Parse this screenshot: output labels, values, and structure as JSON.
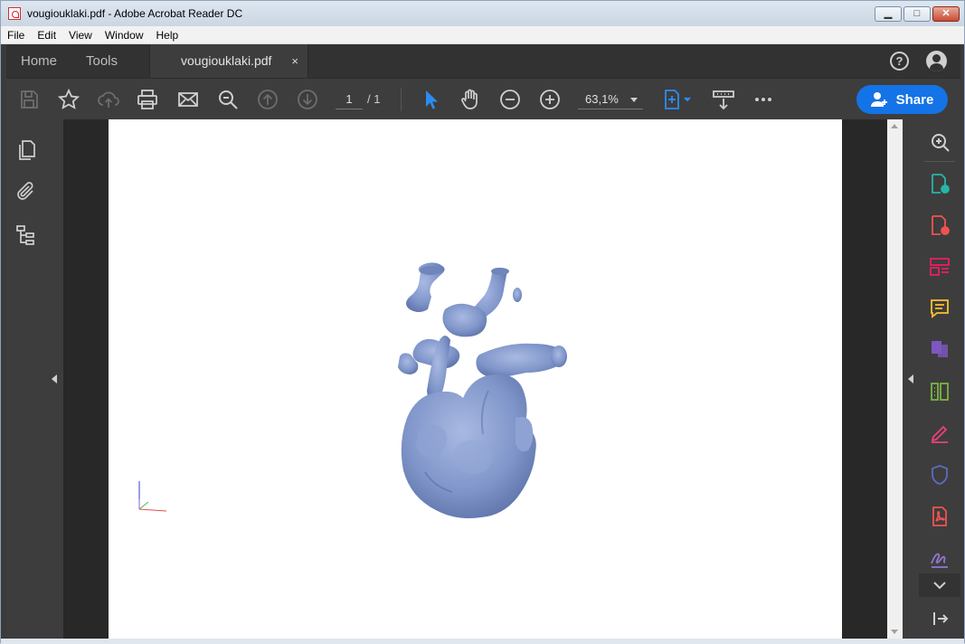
{
  "window": {
    "title": "vougiouklaki.pdf - Adobe Acrobat Reader DC",
    "buttons": {
      "minimize": "▁",
      "maximize": "□",
      "close": "✕"
    }
  },
  "menu": [
    "File",
    "Edit",
    "View",
    "Window",
    "Help"
  ],
  "tabs": {
    "home": "Home",
    "tools": "Tools",
    "document": "vougiouklaki.pdf",
    "close": "×"
  },
  "toolbar": {
    "page_current": "1",
    "page_total": "/ 1",
    "zoom": "63,1%",
    "share_label": "Share"
  },
  "icons": {
    "left_rail": [
      "pages-icon",
      "attachments-icon",
      "bookmarks-icon"
    ],
    "right_rail": [
      "zoom-search-icon",
      "export-pdf-icon",
      "create-pdf-icon",
      "organize-pages-icon",
      "comment-icon",
      "combine-files-icon",
      "compress-icon",
      "fill-sign-icon",
      "protect-icon",
      "more-pdf-icon",
      "sign-icon",
      "expand-down-icon",
      "collapse-panel-icon"
    ]
  },
  "colors": {
    "accent": "#1473e6",
    "model": "#7f95c9",
    "panel": "#3d3d3d"
  }
}
